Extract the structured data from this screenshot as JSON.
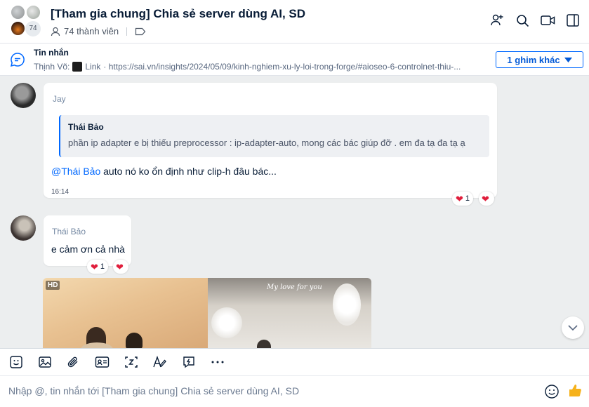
{
  "header": {
    "title": "[Tham gia chung] Chia sẻ server dùng AI, SD",
    "avatar_count": "74",
    "members": "74 thành viên"
  },
  "pinned": {
    "title": "Tin nhắn",
    "sender": "Thịnh Võ:",
    "link_label": "Link",
    "link_url": "· https://sai.vn/insights/2024/05/09/kinh-nghiem-xu-ly-loi-trong-forge/#aioseo-6-controlnet-thiu-...",
    "more_button": "1 ghim khác"
  },
  "messages": [
    {
      "sender": "Jay",
      "quote": {
        "name": "Thái Bảo",
        "text": "phần ip adapter e bị thiếu preprocessor : ip-adapter-auto, mong các bác giúp đỡ . em đa tạ đa tạ ạ"
      },
      "mention": "@Thái Bảo",
      "text": " auto nó ko ổn định như clip-h đâu bác...",
      "time": "16:14",
      "reaction_count": "1"
    },
    {
      "sender": "Thái Bảo",
      "text": "e cảm ơn cả nhà",
      "reaction_count": "1"
    }
  ],
  "photo": {
    "badge": "HD",
    "caption": "My love for you"
  },
  "composer": {
    "placeholder": "Nhập @, tin nhắn tới [Tham gia chung] Chia sẻ server dùng AI, SD"
  },
  "colors": {
    "accent": "#0068ff",
    "reaction": "#e01e3c"
  }
}
